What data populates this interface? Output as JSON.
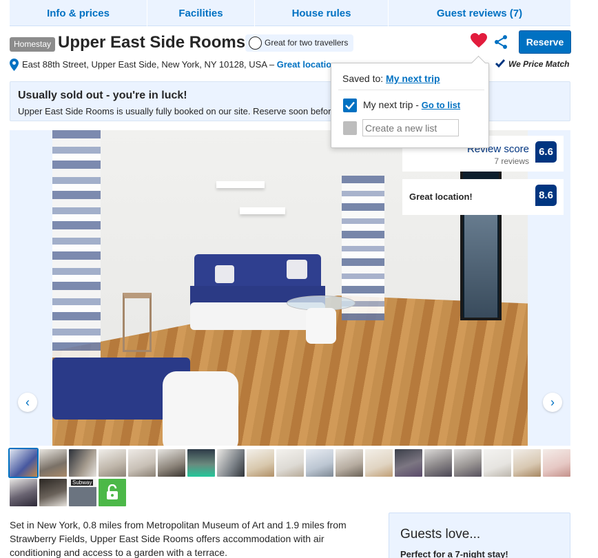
{
  "tabs": [
    "Info & prices",
    "Facilities",
    "House rules",
    "Guest reviews (7)"
  ],
  "header": {
    "badge": "Homestay",
    "title": "Upper East Side Rooms",
    "pill": "Great for two travellers",
    "reserve": "Reserve"
  },
  "address": {
    "text": "East 88th Street, Upper East Side, New York, NY 10128, USA –",
    "location_link": "Great location"
  },
  "price_match": "We Price Match",
  "soldout": {
    "title": "Usually sold out - you're in luck!",
    "text": "Upper East Side Rooms is usually fully booked on our site. Reserve soon before it's too late!"
  },
  "scores": {
    "review_label": "Review score",
    "review_count": "7 reviews",
    "review_value": "6.6",
    "location_label": "Great location!",
    "location_value": "8.6"
  },
  "popup": {
    "saved_prefix": "Saved to:",
    "saved_list": "My next trip",
    "option_label": "My next trip -",
    "option_link": "Go to list",
    "new_list_placeholder": "Create a new list"
  },
  "description": "Set in New York, 0.8 miles from Metropolitan Museum of Art and 1.9 miles from Strawberry Fields, Upper East Side Rooms offers accommodation with air conditioning and access to a garden with a terrace.",
  "guests_love": {
    "title": "Guests love...",
    "perfect": "Perfect for a 7-night stay!"
  },
  "thumbnail_label": "Subway",
  "colors": {
    "brand_blue": "#0071c2",
    "dark_blue": "#003580",
    "light_blue_bg": "#ebf3ff",
    "heart": "#e21c3d",
    "lock_green": "#4cb848"
  },
  "icons": [
    "pin-icon",
    "heart-icon",
    "share-icon",
    "travellers-icon",
    "price-match-icon",
    "chevron-left-icon",
    "chevron-right-icon",
    "check-icon",
    "lock-icon"
  ]
}
